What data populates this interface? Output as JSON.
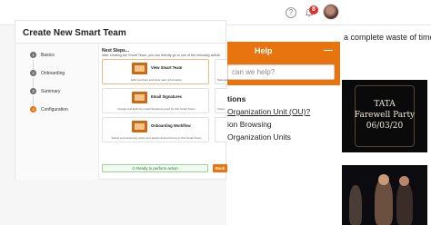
{
  "header": {
    "help_icon": "question-circle-icon",
    "notification_count": "8",
    "bell_icon": "bell-icon"
  },
  "background": {
    "sentence": "a complete waste of time"
  },
  "help_panel": {
    "title": "Help",
    "minimize": "—",
    "search_placeholder": "can we help?",
    "section": "tions",
    "links": [
      "Organization Unit (OU)?",
      "ion Browsing",
      "Organization Units"
    ]
  },
  "photo": {
    "line1": "TATA",
    "line2": "Farewell Party",
    "line3": "06/03/20"
  },
  "modal": {
    "title": "Create New Smart Team",
    "steps": [
      {
        "num": "1",
        "label": "Basics"
      },
      {
        "num": "2",
        "label": "Onboarding"
      },
      {
        "num": "3",
        "label": "Summary"
      },
      {
        "num": "4",
        "label": "Configuration"
      }
    ],
    "next_title": "Next Steps...",
    "next_sub": "After creating the Smart Team, you can directly go to one of the following activiti",
    "cards": [
      {
        "label": "View Smart Team",
        "desc": "Edit members and view team information"
      },
      {
        "label": "Email Signatures",
        "desc": "Design and Edit the Gmail Signature used by this Smart Team"
      },
      {
        "label": "Onboarding Workflow",
        "desc": "Select a provisioning policy and assign desired items to this Smart Team"
      }
    ],
    "peek_labels": [
      "Manage",
      "Views"
    ],
    "ready_label": "Ready to perform action",
    "back_label": "Back"
  },
  "colors": {
    "accent": "#e8740f",
    "ready_border": "#9bd39b",
    "badge": "#d9332b"
  }
}
